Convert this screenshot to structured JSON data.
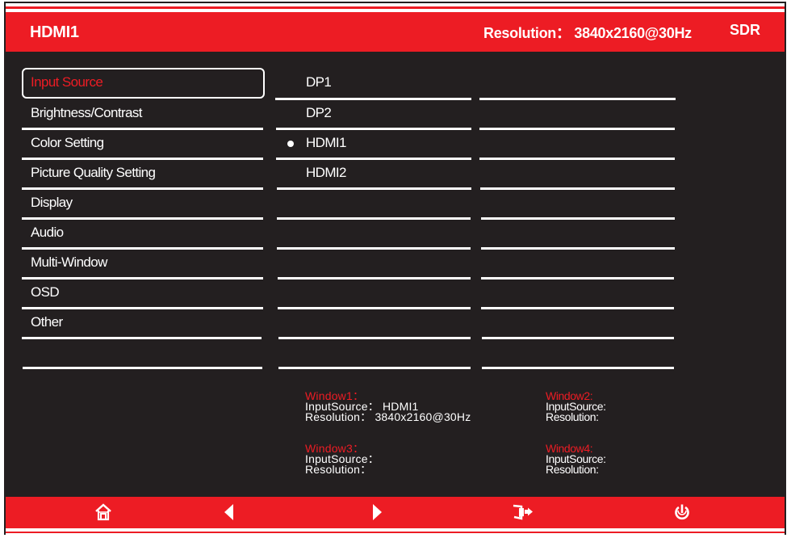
{
  "header": {
    "input_title": "HDMI1",
    "resolution_text": "Resolution： 3840x2160@30Hz",
    "dynamic_range": "SDR"
  },
  "menu": {
    "items": [
      {
        "label": "Input Source",
        "active": true
      },
      {
        "label": "Brightness/Contrast"
      },
      {
        "label": "Color Setting"
      },
      {
        "label": "Picture Quality Setting"
      },
      {
        "label": "Display"
      },
      {
        "label": "Audio"
      },
      {
        "label": "Multi-Window"
      },
      {
        "label": "OSD"
      },
      {
        "label": "Other"
      }
    ]
  },
  "options": {
    "items": [
      {
        "label": "DP1",
        "selected": false
      },
      {
        "label": "DP2",
        "selected": false
      },
      {
        "label": "HDMI1",
        "selected": true
      },
      {
        "label": "HDMI2",
        "selected": false
      }
    ]
  },
  "windows": {
    "w1": {
      "title": "Window1：",
      "input": "InputSource： HDMI1",
      "resolution": "Resolution： 3840x2160@30Hz"
    },
    "w2": {
      "title": "Window2:",
      "input": "InputSource:",
      "resolution": "Resolution:"
    },
    "w3": {
      "title": "Window3：",
      "input": "InputSource：",
      "resolution": "Resolution："
    },
    "w4": {
      "title": "Window4:",
      "input": "InputSource:",
      "resolution": "Resolution:"
    }
  },
  "footer": {
    "buttons": [
      "home-icon",
      "arrow-left-icon",
      "arrow-right-icon",
      "exit-icon",
      "power-icon"
    ]
  },
  "colors": {
    "accent": "#ed1c24",
    "background": "#231f20",
    "text": "#ffffff"
  }
}
